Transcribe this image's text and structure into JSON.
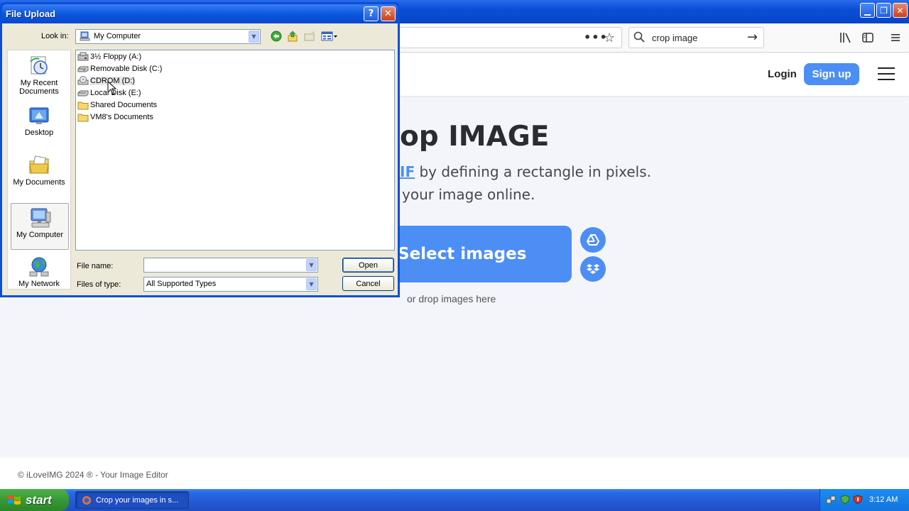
{
  "browser": {
    "toolbar": {
      "url_more_label": "•••",
      "search_value": "crop image"
    }
  },
  "webpage": {
    "header": {
      "login_label": "Login",
      "signup_label": "Sign up"
    },
    "hero": {
      "title": "op IMAGE",
      "subtitle_link": "IF",
      "subtitle_rest": " by defining a rectangle in pixels.",
      "subtitle_line2": "your image online."
    },
    "upload": {
      "select_label": "Select images",
      "drop_text": "or drop images here"
    },
    "footer": {
      "text": "© iLoveIMG 2024 ® - Your Image Editor"
    }
  },
  "dialog": {
    "title": "File Upload",
    "help_label": "?",
    "close_label": "✕",
    "look_in_label": "Look in:",
    "look_in_value": "My Computer",
    "places": [
      {
        "label": "My Recent Documents",
        "icon": "recent-documents-icon"
      },
      {
        "label": "Desktop",
        "icon": "desktop-icon"
      },
      {
        "label": "My Documents",
        "icon": "my-documents-icon"
      },
      {
        "label": "My Computer",
        "icon": "my-computer-icon",
        "active": true
      },
      {
        "label": "My Network",
        "icon": "my-network-icon"
      }
    ],
    "files": [
      {
        "label": "3½ Floppy (A:)",
        "icon": "floppy-drive-icon"
      },
      {
        "label": "Removable Disk (C:)",
        "icon": "removable-disk-icon"
      },
      {
        "label": "CDROM (D:)",
        "icon": "cdrom-drive-icon"
      },
      {
        "label": "Local Disk (E:)",
        "icon": "local-disk-icon"
      },
      {
        "label": "Shared Documents",
        "icon": "folder-icon"
      },
      {
        "label": "VM8's Documents",
        "icon": "folder-icon"
      }
    ],
    "file_name_label": "File name:",
    "file_name_value": "",
    "files_of_type_label": "Files of type:",
    "files_of_type_value": "All Supported Types",
    "open_label": "Open",
    "cancel_label": "Cancel"
  },
  "taskbar": {
    "start_label": "start",
    "task_label": "Crop your images in s...",
    "clock": "3:12 AM"
  },
  "colors": {
    "xp_blue": "#0a4fd8",
    "accent": "#4d8ef5",
    "dialog_face": "#ece9d8"
  }
}
